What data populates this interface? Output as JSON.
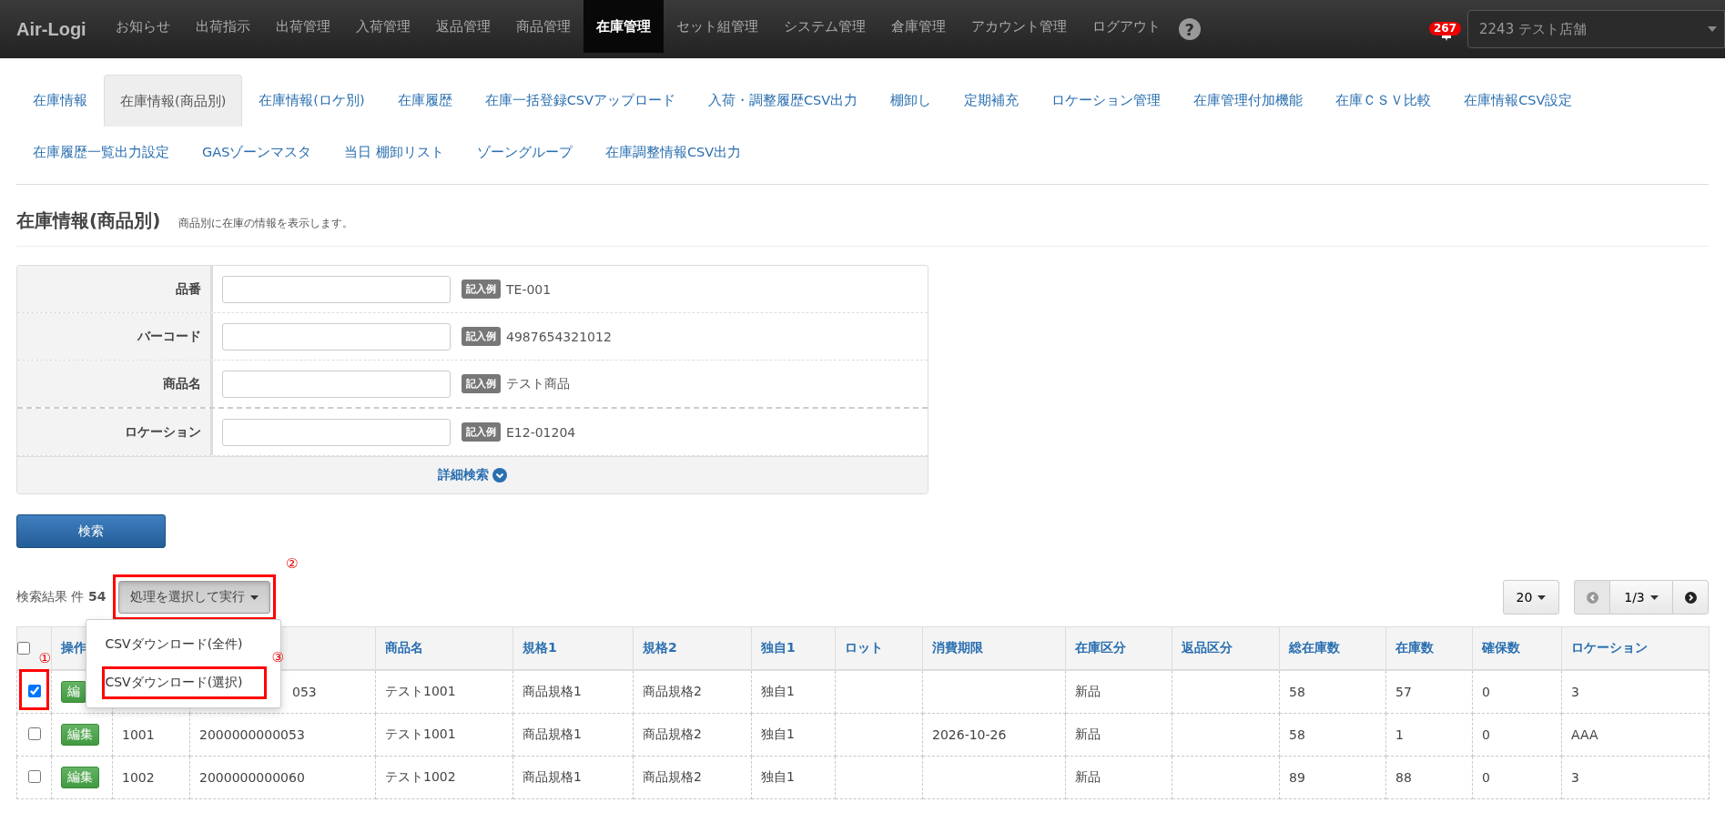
{
  "nav": {
    "brand": "Air-Logi",
    "items": [
      {
        "label": "お知らせ",
        "selected": false
      },
      {
        "label": "出荷指示",
        "selected": false
      },
      {
        "label": "出荷管理",
        "selected": false
      },
      {
        "label": "入荷管理",
        "selected": false
      },
      {
        "label": "返品管理",
        "selected": false
      },
      {
        "label": "商品管理",
        "selected": false
      },
      {
        "label": "在庫管理",
        "selected": true
      },
      {
        "label": "セット組管理",
        "selected": false
      },
      {
        "label": "システム管理",
        "selected": false
      },
      {
        "label": "倉庫管理",
        "selected": false
      },
      {
        "label": "アカウント管理",
        "selected": false
      },
      {
        "label": "ログアウト",
        "selected": false
      }
    ],
    "help": "?",
    "notification_count": "267",
    "store_select": "2243 テスト店舗"
  },
  "subtabs": [
    [
      {
        "label": "在庫情報",
        "selected": false
      },
      {
        "label": "在庫情報(商品別)",
        "selected": true
      },
      {
        "label": "在庫情報(ロケ別)",
        "selected": false
      },
      {
        "label": "在庫履歴",
        "selected": false
      },
      {
        "label": "在庫一括登録CSVアップロード",
        "selected": false
      },
      {
        "label": "入荷・調整履歴CSV出力",
        "selected": false
      },
      {
        "label": "棚卸し",
        "selected": false
      },
      {
        "label": "定期補充",
        "selected": false
      },
      {
        "label": "ロケーション管理",
        "selected": false
      },
      {
        "label": "在庫管理付加機能",
        "selected": false
      },
      {
        "label": "在庫ＣＳＶ比較",
        "selected": false
      },
      {
        "label": "在庫情報CSV設定",
        "selected": false
      }
    ],
    [
      {
        "label": "在庫履歴一覧出力設定",
        "selected": false
      },
      {
        "label": "GASゾーンマスタ",
        "selected": false
      },
      {
        "label": "当日 棚卸リスト",
        "selected": false
      },
      {
        "label": "ゾーングループ",
        "selected": false
      },
      {
        "label": "在庫調整情報CSV出力",
        "selected": false
      }
    ]
  ],
  "page": {
    "title": "在庫情報(商品別)",
    "description": "商品別に在庫の情報を表示します。"
  },
  "search_form": {
    "fields": [
      {
        "label": "品番",
        "example_badge": "記入例",
        "example": "TE-001"
      },
      {
        "label": "バーコード",
        "example_badge": "記入例",
        "example": "4987654321012"
      },
      {
        "label": "商品名",
        "example_badge": "記入例",
        "example": "テスト商品"
      },
      {
        "label": "ロケーション",
        "example_badge": "記入例",
        "example": "E12-01204"
      }
    ],
    "advanced_toggle": "詳細検索",
    "submit": "検索"
  },
  "results": {
    "summary": "検索結果 件 **54**",
    "action_button": {
      "label": "処理を選択して実行",
      "highlight": true,
      "marker": "②",
      "expanded": true
    },
    "action_menu": [
      {
        "label": "CSVダウンロード(全件)",
        "highlight": false
      },
      {
        "label": "CSVダウンロード(選択)",
        "highlight": true,
        "marker": "③"
      }
    ],
    "page_size": "20",
    "pager": {
      "prev_disabled": true,
      "page": "1/3",
      "next_disabled": false
    }
  },
  "table": {
    "header_checked": false,
    "columns": [
      "操作",
      "",
      "",
      "商品名",
      "規格1",
      "規格2",
      "独自1",
      "ロット",
      "消費期限",
      "在庫区分",
      "返品区分",
      "総在庫数",
      "在庫数",
      "確保数",
      "ロケーション"
    ],
    "rows": [
      {
        "checked": true,
        "highlight": true,
        "marker": "①",
        "cells": [
          "編",
          "",
          "053",
          "テスト1001",
          "商品規格1",
          "商品規格2",
          "独自1",
          "",
          "",
          "新品",
          "",
          "58",
          "57",
          "0",
          "3"
        ]
      },
      {
        "checked": false,
        "highlight": false,
        "cells": [
          "編集",
          "1001",
          "2000000000053",
          "テスト1001",
          "商品規格1",
          "商品規格2",
          "独自1",
          "",
          "2026-10-26",
          "新品",
          "",
          "58",
          "1",
          "0",
          "AAA"
        ]
      },
      {
        "checked": false,
        "highlight": false,
        "cells": [
          "編集",
          "1002",
          "2000000000060",
          "テスト1002",
          "商品規格1",
          "商品規格2",
          "独自1",
          "",
          "",
          "新品",
          "",
          "89",
          "88",
          "0",
          "3"
        ]
      }
    ]
  }
}
